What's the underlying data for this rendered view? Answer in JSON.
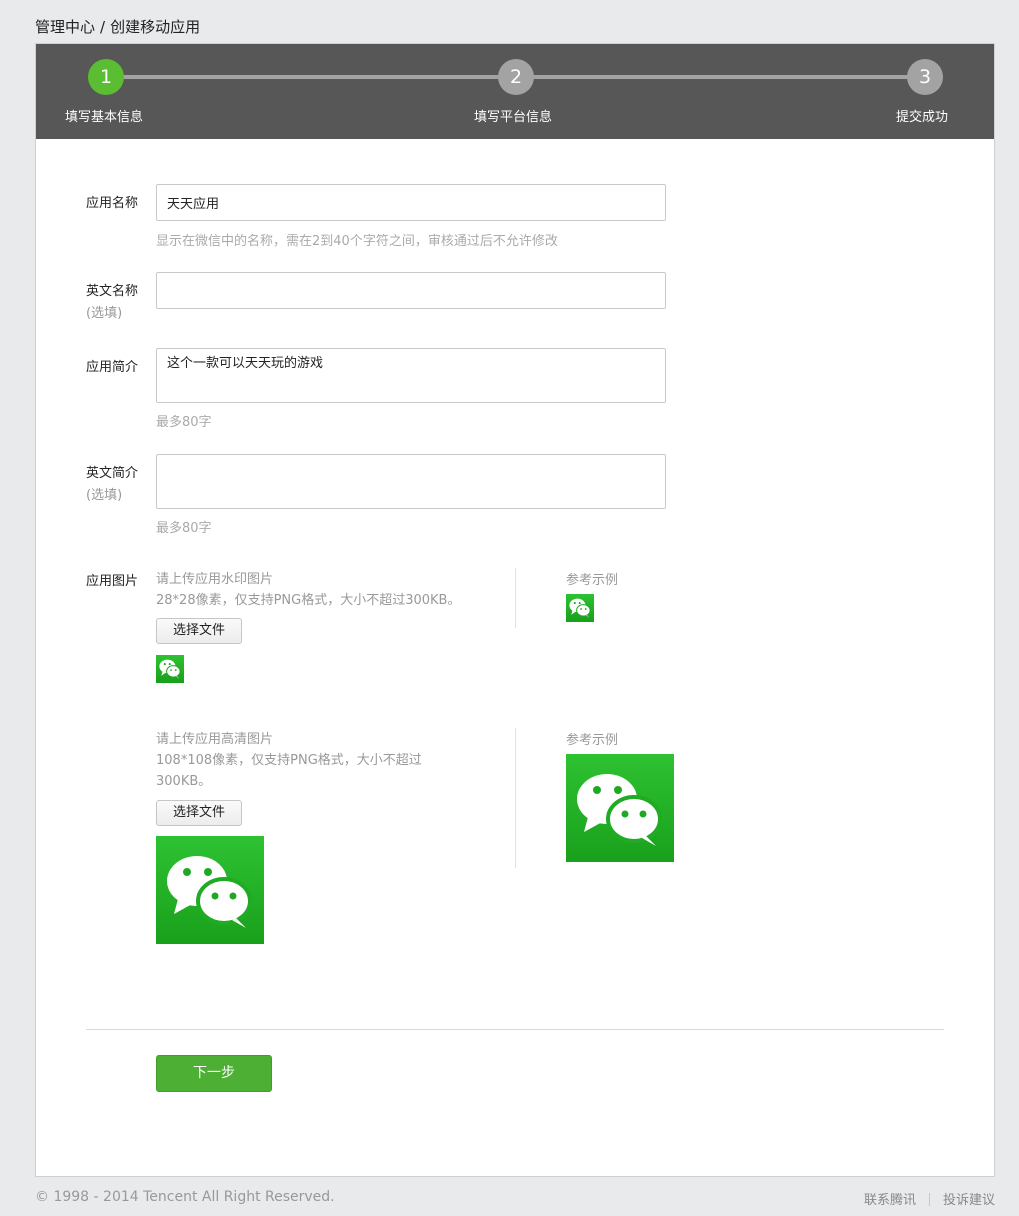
{
  "breadcrumb": {
    "root": "管理中心",
    "separator": "/",
    "current": "创建移动应用"
  },
  "steps": [
    {
      "number": "1",
      "label": "填写基本信息",
      "active": true
    },
    {
      "number": "2",
      "label": "填写平台信息",
      "active": false
    },
    {
      "number": "3",
      "label": "提交成功",
      "active": false
    }
  ],
  "form": {
    "app_name": {
      "label": "应用名称",
      "value": "天天应用",
      "hint": "显示在微信中的名称，需在2到40个字符之间，审核通过后不允许修改"
    },
    "english_name": {
      "label": "英文名称",
      "optional": "(选填)",
      "value": ""
    },
    "app_intro": {
      "label": "应用简介",
      "value": "这个一款可以天天玩的游戏",
      "hint": "最多80字"
    },
    "english_intro": {
      "label": "英文简介",
      "optional": "(选填)",
      "value": "",
      "hint": "最多80字"
    },
    "app_images": {
      "label": "应用图片",
      "watermark": {
        "title": "请上传应用水印图片",
        "spec": "28*28像素，仅支持PNG格式，大小不超过300KB。",
        "button": "选择文件",
        "reference_label": "参考示例"
      },
      "hd": {
        "title": "请上传应用高清图片",
        "spec": "108*108像素，仅支持PNG格式，大小不超过300KB。",
        "button": "选择文件",
        "reference_label": "参考示例"
      }
    },
    "next_button": "下一步"
  },
  "footer": {
    "copyright": "© 1998 - 2014 Tencent All Right Reserved.",
    "links": [
      "联系腾讯",
      "投诉建议"
    ]
  },
  "colors": {
    "step_active": "#5bbd32",
    "step_inactive": "#a3a3a3",
    "stepbar_bg": "#575757",
    "primary_button": "#4db034",
    "wechat_green": "#22b126"
  },
  "icons": {
    "wechat_logo": "wechat-icon"
  }
}
